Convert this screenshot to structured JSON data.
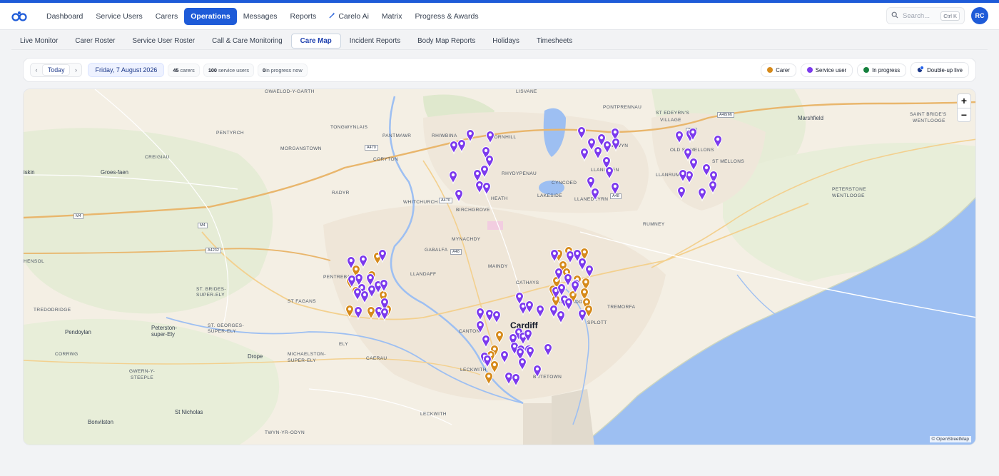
{
  "nav": {
    "items": [
      {
        "label": "Dashboard",
        "active": false
      },
      {
        "label": "Service Users",
        "active": false
      },
      {
        "label": "Carers",
        "active": false
      },
      {
        "label": "Operations",
        "active": true
      },
      {
        "label": "Messages",
        "active": false
      },
      {
        "label": "Reports",
        "active": false
      },
      {
        "label": "Carelo Ai",
        "active": false
      },
      {
        "label": "Matrix",
        "active": false
      },
      {
        "label": "Progress & Awards",
        "active": false
      }
    ],
    "search_placeholder": "Search...",
    "search_shortcut": "Ctrl K",
    "avatar_initials": "RC"
  },
  "subnav": {
    "items": [
      {
        "label": "Live Monitor",
        "active": false
      },
      {
        "label": "Carer Roster",
        "active": false
      },
      {
        "label": "Service User Roster",
        "active": false
      },
      {
        "label": "Call & Care Monitoring",
        "active": false
      },
      {
        "label": "Care Map",
        "active": true
      },
      {
        "label": "Incident Reports",
        "active": false
      },
      {
        "label": "Body Map Reports",
        "active": false
      },
      {
        "label": "Holidays",
        "active": false
      },
      {
        "label": "Timesheets",
        "active": false
      }
    ]
  },
  "filters": {
    "prev_label": "‹",
    "today_label": "Today",
    "next_label": "›",
    "date_label": "Friday, 7 August 2026",
    "carers_count": "45",
    "carers_label": "carers",
    "service_users_count": "100",
    "service_users_label": "service users",
    "in_progress_count": "0",
    "in_progress_label": "in progress now"
  },
  "legend": [
    {
      "label": "Carer",
      "color": "#d68a1a"
    },
    {
      "label": "Service user",
      "color": "#7c3aed"
    },
    {
      "label": "In progress",
      "color": "#15803d"
    },
    {
      "label": "Double-up live",
      "color": "#1e3a8a"
    }
  ],
  "map": {
    "zoom_in": "+",
    "zoom_out": "−",
    "attribution": "© OpenStreetMap",
    "places": [
      {
        "name": "Cardiff",
        "kind": "big"
      },
      {
        "name": "Marshfield",
        "kind": "mid"
      },
      {
        "name": "Groes-faen",
        "kind": "mid"
      },
      {
        "name": "Pendoylan",
        "kind": "mid"
      },
      {
        "name": "Peterston-",
        "kind": "mid"
      },
      {
        "name": "super-Ely",
        "kind": "mid"
      },
      {
        "name": "Drope",
        "kind": "mid"
      },
      {
        "name": "St Nicholas",
        "kind": "mid"
      },
      {
        "name": "Bonvilston",
        "kind": "mid"
      },
      {
        "name": "iskin",
        "kind": "mid"
      },
      {
        "name": "GWAELOD-Y-GARTH",
        "kind": "small"
      },
      {
        "name": "LISVANE",
        "kind": "small"
      },
      {
        "name": "PENTYRCH",
        "kind": "small"
      },
      {
        "name": "CREIGIAU",
        "kind": "small"
      },
      {
        "name": "MORGANSTOWN",
        "kind": "small"
      },
      {
        "name": "TONGWYNLAIS",
        "kind": "small"
      },
      {
        "name": "PANTMAWR",
        "kind": "small"
      },
      {
        "name": "CORYTON",
        "kind": "small"
      },
      {
        "name": "RHIWBINA",
        "kind": "small"
      },
      {
        "name": "THORNHILL",
        "kind": "small"
      },
      {
        "name": "PONTPRENNAU",
        "kind": "small"
      },
      {
        "name": "ST EDEYRN'S",
        "kind": "small"
      },
      {
        "name": "VILLAGE",
        "kind": "small"
      },
      {
        "name": "OLD ST MELLONS",
        "kind": "small"
      },
      {
        "name": "ST MELLONS",
        "kind": "small"
      },
      {
        "name": "SAINT BRIDE'S",
        "kind": "small"
      },
      {
        "name": "WENTLOOGE",
        "kind": "small"
      },
      {
        "name": "RHYDYPENAU",
        "kind": "small"
      },
      {
        "name": "CYNCOED",
        "kind": "small"
      },
      {
        "name": "LLANISHEN",
        "kind": "small"
      },
      {
        "name": "LAKESIDE",
        "kind": "small"
      },
      {
        "name": "LLANEDEYRN",
        "kind": "small"
      },
      {
        "name": "LLANRUMNEY",
        "kind": "small"
      },
      {
        "name": "PENTWYN",
        "kind": "small"
      },
      {
        "name": "HEATH",
        "kind": "small"
      },
      {
        "name": "WHITCHURCH",
        "kind": "small"
      },
      {
        "name": "BIRCHGROVE",
        "kind": "small"
      },
      {
        "name": "RADYR",
        "kind": "small"
      },
      {
        "name": "PETERSTONE",
        "kind": "small"
      },
      {
        "name": "WENTLOOGE",
        "kind": "small"
      },
      {
        "name": "RUMNEY",
        "kind": "small"
      },
      {
        "name": "MYNACHDY",
        "kind": "small"
      },
      {
        "name": "GABALFA",
        "kind": "small"
      },
      {
        "name": "MAINDY",
        "kind": "small"
      },
      {
        "name": "LLANDAFF",
        "kind": "small"
      },
      {
        "name": "PENTREBANE",
        "kind": "small"
      },
      {
        "name": "ST. BRIDES-",
        "kind": "small"
      },
      {
        "name": "SUPER-ELY",
        "kind": "small"
      },
      {
        "name": "ST FAGANS",
        "kind": "small"
      },
      {
        "name": "TREDODRIDGE",
        "kind": "small"
      },
      {
        "name": "ST. GEORGES-",
        "kind": "small"
      },
      {
        "name": "SUPER-ELY",
        "kind": "small"
      },
      {
        "name": "ELY",
        "kind": "small"
      },
      {
        "name": "CANTON",
        "kind": "small"
      },
      {
        "name": "CATHAYS",
        "kind": "small"
      },
      {
        "name": "ADAMSDOWN",
        "kind": "small"
      },
      {
        "name": "SPLOTT",
        "kind": "small"
      },
      {
        "name": "TREMORFA",
        "kind": "small"
      },
      {
        "name": "CAERAU",
        "kind": "small"
      },
      {
        "name": "MICHAELSTON-",
        "kind": "small"
      },
      {
        "name": "SUPER-ELY",
        "kind": "small"
      },
      {
        "name": "CORRWG",
        "kind": "small"
      },
      {
        "name": "GWERN-Y-",
        "kind": "small"
      },
      {
        "name": "STEEPLE",
        "kind": "small"
      },
      {
        "name": "LECKWITH",
        "kind": "small"
      },
      {
        "name": "LECKWITH",
        "kind": "small"
      },
      {
        "name": "BUTETOWN",
        "kind": "small"
      },
      {
        "name": "TWYN-YR-ODYN",
        "kind": "small"
      },
      {
        "name": "HENSOL",
        "kind": "small"
      }
    ],
    "roads": [
      "A470",
      "A470",
      "A48",
      "A48(M)",
      "A48",
      "M4",
      "M4",
      "A4232",
      "A48"
    ]
  }
}
